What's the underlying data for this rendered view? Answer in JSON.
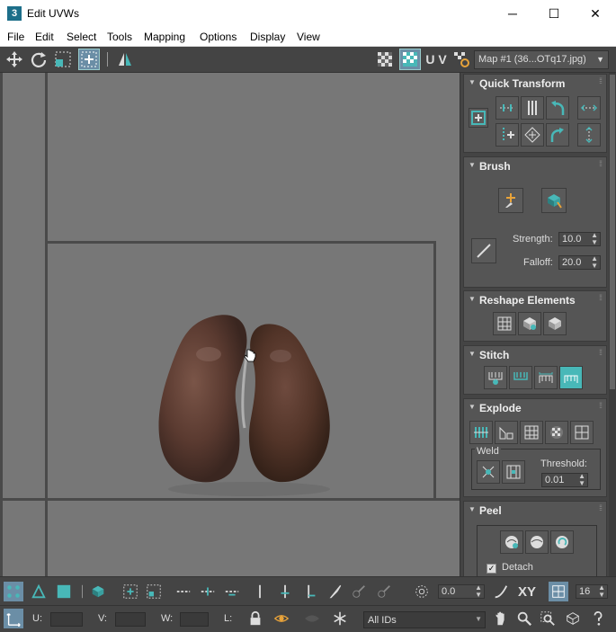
{
  "window": {
    "app_icon_text": "3",
    "title": "Edit UVWs",
    "minimize": "─",
    "maximize": "☐",
    "close": "✕"
  },
  "menu": [
    "File",
    "Edit",
    "Select",
    "Tools",
    "Mapping",
    "Options",
    "Display",
    "View"
  ],
  "toolbar": {
    "uv_label": "U V",
    "map_select": "Map #1 (36...OTq17.jpg)"
  },
  "panel": {
    "quick_transform": {
      "title": "Quick Transform"
    },
    "brush": {
      "title": "Brush",
      "strength_label": "Strength:",
      "strength_value": "10.0",
      "falloff_label": "Falloff:",
      "falloff_value": "20.0"
    },
    "reshape": {
      "title": "Reshape Elements"
    },
    "stitch": {
      "title": "Stitch"
    },
    "explode": {
      "title": "Explode",
      "weld_label": "Weld",
      "threshold_label": "Threshold:",
      "threshold_value": "0.01"
    },
    "peel": {
      "title": "Peel",
      "detach_label": "Detach",
      "detach_checked": true
    }
  },
  "bottom_bar": {
    "rotate_value": "0.0",
    "xy_label": "XY",
    "grid_value": "16",
    "u_label": "U:",
    "v_label": "V:",
    "w_label": "W:",
    "l_label": "L:",
    "ids_select": "All IDs"
  },
  "colors": {
    "accent": "#48b8b8",
    "viewport_bg": "#777777",
    "panel_bg": "#444444"
  }
}
